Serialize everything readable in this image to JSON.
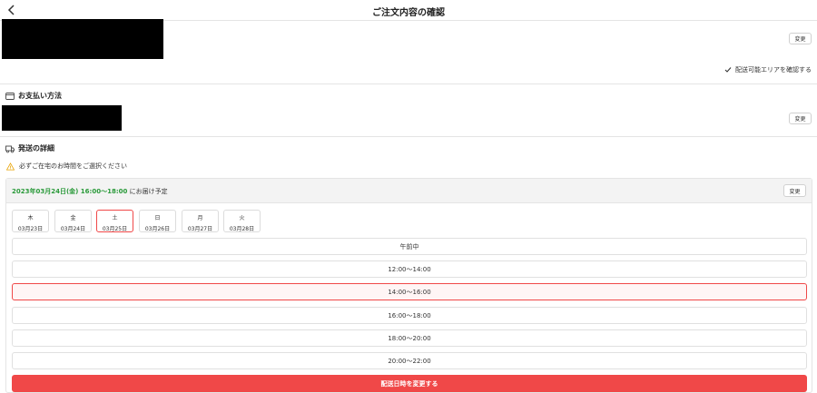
{
  "header": {
    "title": "ご注文内容の確認",
    "back_icon": "chevron-left-icon"
  },
  "address": {
    "change_label": "変更",
    "area_check_label": "配送可能エリアを確認する"
  },
  "payment": {
    "title": "お支払い方法",
    "icon": "credit-card-icon",
    "change_label": "変更"
  },
  "shipping": {
    "title": "発送の詳細",
    "icon": "truck-icon",
    "warning": "必ずご在宅のお時間をご選択ください",
    "warning_color": "#e8a200",
    "delivery_date": "2023年03月24日(金) 16:00〜18:00",
    "delivery_suffix": " にお届け予定",
    "date_color": "#2a9a3a",
    "change_label": "変更",
    "days": [
      {
        "dow": "木",
        "date": "03月23日"
      },
      {
        "dow": "金",
        "date": "03月24日"
      },
      {
        "dow": "土",
        "date": "03月25日"
      },
      {
        "dow": "日",
        "date": "03月26日"
      },
      {
        "dow": "月",
        "date": "03月27日"
      },
      {
        "dow": "火",
        "date": "03月28日"
      }
    ],
    "selected_day": "土",
    "slots": [
      "午前中",
      "12:00〜14:00",
      "14:00〜16:00",
      "16:00〜18:00",
      "18:00〜20:00",
      "20:00〜22:00"
    ],
    "selected_slot": "14:00〜16:00",
    "submit_label": "配送日時を変更する",
    "accent_color": "#f04848"
  }
}
